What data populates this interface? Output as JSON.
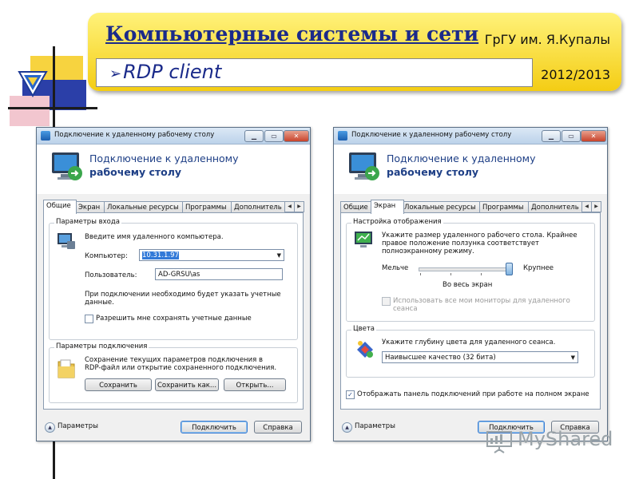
{
  "slide": {
    "title": "Компьютерные системы и сети",
    "university": "ГрГУ им. Я.Купалы",
    "subtitle": "RDP client",
    "year": "2012/2013",
    "watermark": "MyShared",
    "accent_colors": {
      "band": "#f4cd14",
      "title": "#1b2a8a",
      "deco_yellow": "#f7d33f",
      "deco_blue": "#2b3fa8",
      "deco_pink": "#f2c6cf"
    }
  },
  "left_window": {
    "titlebar": "Подключение к удаленному рабочему столу",
    "header_line1": "Подключение к удаленному",
    "header_line2": "рабочему столу",
    "tabs": [
      "Общие",
      "Экран",
      "Локальные ресурсы",
      "Программы",
      "Дополнитель"
    ],
    "active_tab": "Общие",
    "logon_group": {
      "label": "Параметры входа",
      "prompt": "Введите имя удаленного компьютера.",
      "computer_label": "Компьютер:",
      "computer_value": "10.31.1.97",
      "user_label": "Пользователь:",
      "user_value": "AD-GRSU\\as",
      "note_line1": "При подключении необходимо будет указать учетные",
      "note_line2": "данные.",
      "save_creds_label": "Разрешить мне сохранять учетные данные"
    },
    "connection_group": {
      "label": "Параметры подключения",
      "desc_line1": "Сохранение текущих параметров подключения в",
      "desc_line2": "RDP-файл или открытие сохраненного подключения.",
      "save_button": "Сохранить",
      "save_as_button": "Сохранить как...",
      "open_button": "Открыть..."
    },
    "footer": {
      "params_label": "Параметры",
      "connect_button": "Подключить",
      "help_button": "Справка"
    }
  },
  "right_window": {
    "titlebar": "Подключение к удаленному рабочему столу",
    "header_line1": "Подключение к удаленному",
    "header_line2": "рабочему столу",
    "tabs": [
      "Общие",
      "Экран",
      "Локальные ресурсы",
      "Программы",
      "Дополнитель"
    ],
    "active_tab": "Экран",
    "display_group": {
      "label": "Настройка отображения",
      "desc_line1": "Укажите размер удаленного рабочего стола. Крайнее",
      "desc_line2": "правое положение ползунка соответствует",
      "desc_line3": "полноэкранному режиму.",
      "smaller_label": "Мельче",
      "larger_label": "Крупнее",
      "slider_value_label": "Во весь экран",
      "slider_position": 1.0,
      "all_monitors_line1": "Использовать все мои мониторы для удаленного",
      "all_monitors_line2": "сеанса"
    },
    "colors_group": {
      "label": "Цвета",
      "prompt": "Укажите глубину цвета для удаленного сеанса.",
      "depth_value": "Наивысшее качество (32 бита)"
    },
    "fullscreen_bar_label": "Отображать панель подключений при работе на полном экране",
    "fullscreen_bar_checked": true,
    "footer": {
      "params_label": "Параметры",
      "connect_button": "Подключить",
      "help_button": "Справка"
    }
  }
}
